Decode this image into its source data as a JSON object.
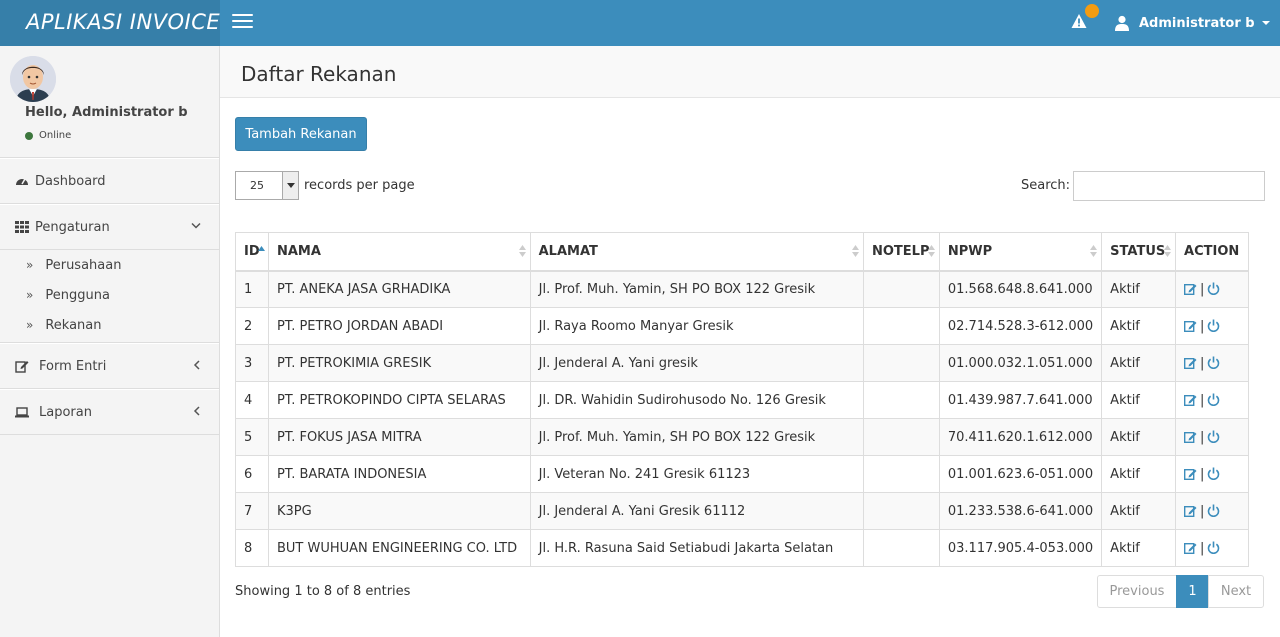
{
  "app": {
    "title": "APLIKASI INVOICE"
  },
  "header": {
    "user_name": "Administrator b",
    "badge_color": "#f39c12",
    "brand_color": "#3c8dbc"
  },
  "sidebar": {
    "greeting": "Hello, Administrator b",
    "status": "Online",
    "items": [
      {
        "label": "Dashboard",
        "icon": "dashboard-icon"
      },
      {
        "label": "Pengaturan",
        "icon": "grid-icon",
        "expanded": true,
        "children": [
          {
            "label": "Perusahaan"
          },
          {
            "label": "Pengguna"
          },
          {
            "label": "Rekanan"
          }
        ]
      },
      {
        "label": "Form Entri",
        "icon": "edit-icon",
        "expanded": false
      },
      {
        "label": "Laporan",
        "icon": "laptop-icon",
        "expanded": false
      }
    ]
  },
  "main": {
    "page_title": "Daftar Rekanan",
    "add_button": "Tambah Rekanan",
    "length_value": "25",
    "length_label": "records per page",
    "search_label": "Search:",
    "search_value": "",
    "columns": [
      "ID",
      "NAMA",
      "ALAMAT",
      "NOTELP",
      "NPWP",
      "STATUS",
      "ACTION"
    ],
    "rows": [
      {
        "id": "1",
        "nama": "PT. ANEKA JASA GRHADIKA",
        "alamat": "Jl. Prof. Muh. Yamin, SH PO BOX 122 Gresik",
        "notelp": "",
        "npwp": "01.568.648.8.641.000",
        "status": "Aktif"
      },
      {
        "id": "2",
        "nama": "PT. PETRO JORDAN ABADI",
        "alamat": "Jl. Raya Roomo Manyar Gresik",
        "notelp": "",
        "npwp": "02.714.528.3-612.000",
        "status": "Aktif"
      },
      {
        "id": "3",
        "nama": "PT. PETROKIMIA GRESIK",
        "alamat": "Jl. Jenderal A. Yani gresik",
        "notelp": "",
        "npwp": "01.000.032.1.051.000",
        "status": "Aktif"
      },
      {
        "id": "4",
        "nama": "PT. PETROKOPINDO CIPTA SELARAS",
        "alamat": "Jl. DR. Wahidin Sudirohusodo No. 126 Gresik",
        "notelp": "",
        "npwp": "01.439.987.7.641.000",
        "status": "Aktif"
      },
      {
        "id": "5",
        "nama": "PT. FOKUS JASA MITRA",
        "alamat": "Jl. Prof. Muh. Yamin, SH PO BOX 122 Gresik",
        "notelp": "",
        "npwp": "70.411.620.1.612.000",
        "status": "Aktif"
      },
      {
        "id": "6",
        "nama": "PT. BARATA INDONESIA",
        "alamat": "Jl. Veteran No. 241 Gresik 61123",
        "notelp": "",
        "npwp": "01.001.623.6-051.000",
        "status": "Aktif"
      },
      {
        "id": "7",
        "nama": "K3PG",
        "alamat": "Jl. Jenderal A. Yani Gresik 61112",
        "notelp": "",
        "npwp": "01.233.538.6-641.000",
        "status": "Aktif"
      },
      {
        "id": "8",
        "nama": "BUT WUHUAN ENGINEERING CO. LTD",
        "alamat": "Jl. H.R. Rasuna Said Setiabudi Jakarta Selatan",
        "notelp": "",
        "npwp": "03.117.905.4-053.000",
        "status": "Aktif"
      }
    ],
    "action_separator": "|",
    "info": "Showing 1 to 8 of 8 entries",
    "pagination": {
      "prev": "Previous",
      "current": "1",
      "next": "Next"
    }
  }
}
